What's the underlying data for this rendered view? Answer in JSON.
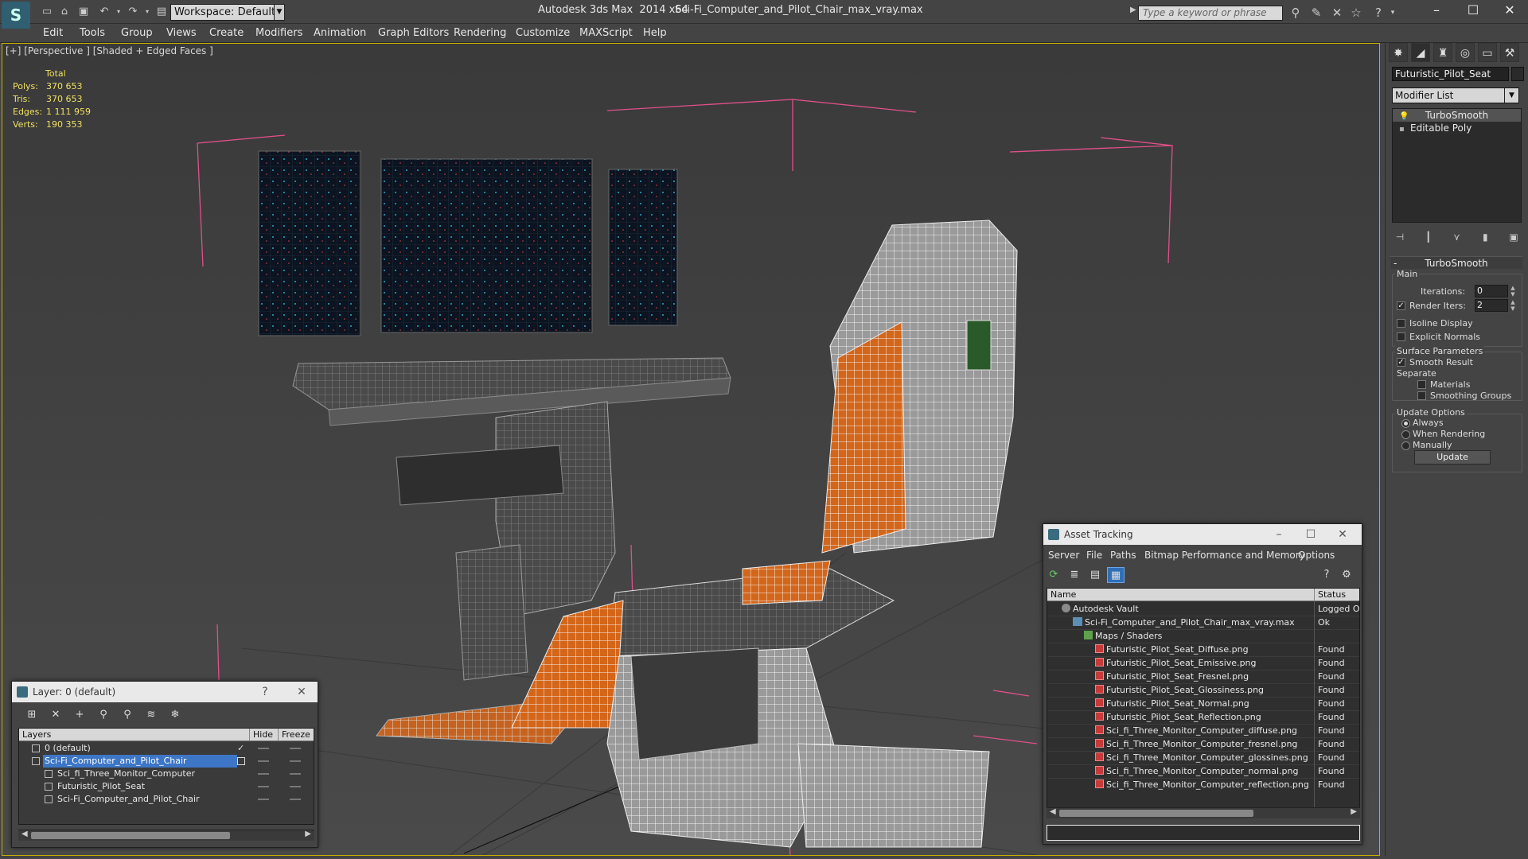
{
  "window": {
    "app_title": "Autodesk 3ds Max  2014 x64",
    "file_title": "Sci-Fi_Computer_and_Pilot_Chair_max_vray.max",
    "workspace": "Workspace: Default",
    "search_placeholder": "Type a keyword or phrase",
    "controls": {
      "minimize": "–",
      "maximize": "☐",
      "close": "✕"
    }
  },
  "menu": [
    "Edit",
    "Tools",
    "Group",
    "Views",
    "Create",
    "Modifiers",
    "Animation",
    "Graph Editors",
    "Rendering",
    "Customize",
    "MAXScript",
    "Help"
  ],
  "viewport": {
    "label": "[+] [Perspective ] [Shaded + Edged Faces ]",
    "stats": {
      "header": "Total",
      "rows": [
        {
          "key": "Polys:",
          "value": "370 653"
        },
        {
          "key": "Tris:",
          "value": "370 653"
        },
        {
          "key": "Edges:",
          "value": "1 111 959"
        },
        {
          "key": "Verts:",
          "value": "190 353"
        }
      ]
    }
  },
  "command_panel": {
    "object_name": "Futuristic_Pilot_Seat",
    "modifier_list": "Modifier List",
    "stack": [
      "TurboSmooth",
      "Editable Poly"
    ],
    "rollout_title": "TurboSmooth",
    "main_group": "Main",
    "iterations_label": "Iterations:",
    "iterations_value": "0",
    "render_iters_label": "Render Iters:",
    "render_iters_value": "2",
    "render_iters_checked": true,
    "isoline_label": "Isoline Display",
    "isoline_checked": false,
    "explicit_normals_label": "Explicit Normals",
    "explicit_normals_checked": false,
    "surface_group": "Surface Parameters",
    "smooth_result_label": "Smooth Result",
    "smooth_result_checked": true,
    "separate_label": "Separate",
    "materials_label": "Materials",
    "materials_checked": false,
    "smoothing_groups_label": "Smoothing Groups",
    "smoothing_groups_checked": false,
    "update_group": "Update Options",
    "always_label": "Always",
    "when_rendering_label": "When Rendering",
    "manually_label": "Manually",
    "update_option_selected": "Always",
    "update_button": "Update"
  },
  "asset_tracking": {
    "title": "Asset Tracking",
    "menu": [
      "Server",
      "File",
      "Paths",
      "Bitmap Performance and Memory",
      "Options"
    ],
    "columns": {
      "name": "Name",
      "status": "Status"
    },
    "rows": [
      {
        "name": "Autodesk Vault",
        "status": "Logged O",
        "icon": "vault-icon",
        "indent": 1
      },
      {
        "name": "Sci-Fi_Computer_and_Pilot_Chair_max_vray.max",
        "status": "Ok",
        "icon": "max-file-icon",
        "indent": 2
      },
      {
        "name": "Maps / Shaders",
        "status": "",
        "icon": "folder-icon",
        "indent": 3
      },
      {
        "name": "Futuristic_Pilot_Seat_Diffuse.png",
        "status": "Found",
        "icon": "png-icon",
        "indent": 4
      },
      {
        "name": "Futuristic_Pilot_Seat_Emissive.png",
        "status": "Found",
        "icon": "png-icon",
        "indent": 4
      },
      {
        "name": "Futuristic_Pilot_Seat_Fresnel.png",
        "status": "Found",
        "icon": "png-icon",
        "indent": 4
      },
      {
        "name": "Futuristic_Pilot_Seat_Glossiness.png",
        "status": "Found",
        "icon": "png-icon",
        "indent": 4
      },
      {
        "name": "Futuristic_Pilot_Seat_Normal.png",
        "status": "Found",
        "icon": "png-icon",
        "indent": 4
      },
      {
        "name": "Futuristic_Pilot_Seat_Reflection.png",
        "status": "Found",
        "icon": "png-icon",
        "indent": 4
      },
      {
        "name": "Sci_fi_Three_Monitor_Computer_diffuse.png",
        "status": "Found",
        "icon": "png-icon",
        "indent": 4
      },
      {
        "name": "Sci_fi_Three_Monitor_Computer_fresnel.png",
        "status": "Found",
        "icon": "png-icon",
        "indent": 4
      },
      {
        "name": "Sci_fi_Three_Monitor_Computer_glossines.png",
        "status": "Found",
        "icon": "png-icon",
        "indent": 4
      },
      {
        "name": "Sci_fi_Three_Monitor_Computer_normal.png",
        "status": "Found",
        "icon": "png-icon",
        "indent": 4
      },
      {
        "name": "Sci_fi_Three_Monitor_Computer_reflection.png",
        "status": "Found",
        "icon": "png-icon",
        "indent": 4
      }
    ]
  },
  "layer_dialog": {
    "title": "Layer: 0 (default)",
    "help": "?",
    "close": "✕",
    "columns": {
      "layers": "Layers",
      "hide": "Hide",
      "freeze": "Freeze"
    },
    "rows": [
      {
        "name": "0 (default)",
        "indent": 1,
        "selected": false,
        "current": true
      },
      {
        "name": "Sci-Fi_Computer_and_Pilot_Chair",
        "indent": 1,
        "selected": true,
        "current": false
      },
      {
        "name": "Sci_fi_Three_Monitor_Computer",
        "indent": 2,
        "selected": false,
        "current": false
      },
      {
        "name": "Futuristic_Pilot_Seat",
        "indent": 2,
        "selected": false,
        "current": false
      },
      {
        "name": "Sci-Fi_Computer_and_Pilot_Chair",
        "indent": 2,
        "selected": false,
        "current": false
      }
    ]
  },
  "colors": {
    "accent_selection": "#3d76c6",
    "viewport_border": "#c8b000",
    "stats_text": "#f0e060",
    "wire_orange": "#d4661a",
    "bbox_pink": "#e0508a"
  }
}
